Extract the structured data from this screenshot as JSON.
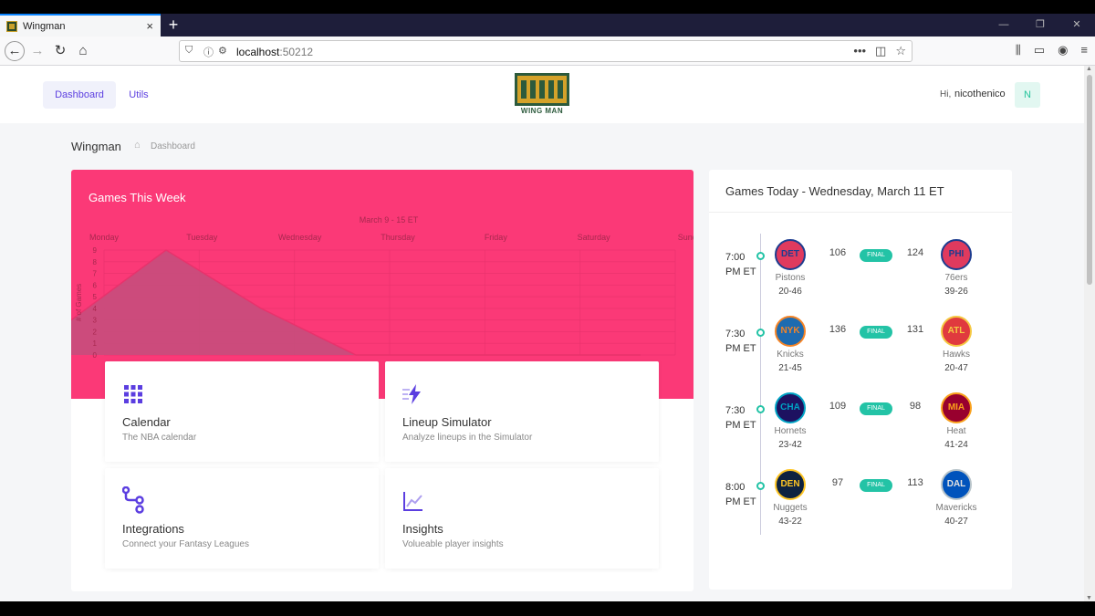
{
  "browser": {
    "tab_title": "Wingman",
    "url_host": "localhost",
    "url_port": ":50212"
  },
  "header": {
    "nav": [
      {
        "label": "Dashboard"
      },
      {
        "label": "Utils"
      }
    ],
    "logo_text": "WING MAN",
    "greeting": "Hi,",
    "username": "nicothenico",
    "avatar_initial": "N"
  },
  "breadcrumb": {
    "title": "Wingman",
    "page": "Dashboard"
  },
  "week": {
    "title": "Games This Week",
    "chart_data": {
      "type": "area",
      "subtitle": "March 9 - 15 ET",
      "categories": [
        "Monday",
        "Tuesday",
        "Wednesday",
        "Thursday",
        "Friday",
        "Saturday",
        "Sunday"
      ],
      "values": [
        3,
        9,
        4,
        0,
        0,
        0,
        0
      ],
      "ylabel": "# of Games",
      "ylim": [
        0,
        9
      ],
      "yticks": [
        0,
        1,
        2,
        3,
        4,
        5,
        6,
        7,
        8,
        9
      ],
      "grid": true,
      "colors": {
        "background": "#fb3977",
        "area": "#c74e7c",
        "line": "#e8326c",
        "text": "#a8284f"
      }
    }
  },
  "cards": [
    {
      "title": "Calendar",
      "subtitle": "The NBA calendar",
      "icon": "grid-icon"
    },
    {
      "title": "Lineup Simulator",
      "subtitle": "Analyze lineups in the Simulator",
      "icon": "lightning-icon"
    },
    {
      "title": "Integrations",
      "subtitle": "Connect your Fantasy Leagues",
      "icon": "nodes-icon"
    },
    {
      "title": "Insights",
      "subtitle": "Volueable player insights",
      "icon": "line-chart-icon"
    }
  ],
  "today": {
    "title": "Games Today - Wednesday, March 11 ET",
    "games": [
      {
        "time": "7:00 PM ET",
        "status": "FINAL",
        "home": {
          "abbr": "DET",
          "name": "Pistons",
          "record": "20-46",
          "score": "106",
          "bg": "#e03a5e",
          "fg": "#1d3c8f",
          "border": "#1d3c8f"
        },
        "away": {
          "abbr": "PHI",
          "name": "76ers",
          "record": "39-26",
          "score": "124",
          "bg": "#e03a5e",
          "fg": "#1d3c8f",
          "border": "#1d3c8f"
        }
      },
      {
        "time": "7:30 PM ET",
        "status": "FINAL",
        "home": {
          "abbr": "NYK",
          "name": "Knicks",
          "record": "21-45",
          "score": "136",
          "bg": "#1e6bb0",
          "fg": "#f58426",
          "border": "#f58426"
        },
        "away": {
          "abbr": "ATL",
          "name": "Hawks",
          "record": "20-47",
          "score": "131",
          "bg": "#e03a3e",
          "fg": "#f5c842",
          "border": "#f5c842"
        }
      },
      {
        "time": "7:30 PM ET",
        "status": "FINAL",
        "home": {
          "abbr": "CHA",
          "name": "Hornets",
          "record": "23-42",
          "score": "109",
          "bg": "#1d1160",
          "fg": "#00a3c4",
          "border": "#00a3c4"
        },
        "away": {
          "abbr": "MIA",
          "name": "Heat",
          "record": "41-24",
          "score": "98",
          "bg": "#98002e",
          "fg": "#f9a01b",
          "border": "#f9a01b"
        }
      },
      {
        "time": "8:00 PM ET",
        "status": "FINAL",
        "home": {
          "abbr": "DEN",
          "name": "Nuggets",
          "record": "43-22",
          "score": "97",
          "bg": "#0e2240",
          "fg": "#fec524",
          "border": "#fec524"
        },
        "away": {
          "abbr": "DAL",
          "name": "Mavericks",
          "record": "40-27",
          "score": "113",
          "bg": "#0053bc",
          "fg": "#e0e0e0",
          "border": "#b8c4ca"
        }
      }
    ]
  }
}
